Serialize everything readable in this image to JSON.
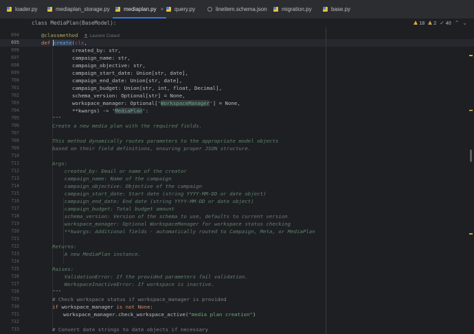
{
  "tabs": [
    {
      "label": "loader.py",
      "icon": "python-file-icon",
      "active": false
    },
    {
      "label": "mediaplan_storage.py",
      "icon": "python-file-icon",
      "active": false
    },
    {
      "label": "mediaplan.py",
      "icon": "python-file-icon",
      "active": true
    },
    {
      "label": "query.py",
      "icon": "python-file-icon",
      "active": false
    },
    {
      "label": "lineitem.schema.json",
      "icon": "json-file-icon",
      "active": false
    },
    {
      "label": "migration.py",
      "icon": "python-file-icon",
      "active": false
    },
    {
      "label": "base.py",
      "icon": "python-file-icon",
      "active": false
    }
  ],
  "tab_close_glyph": "×",
  "breadcrumb": "class MediaPlan(BaseModel):",
  "inspections": {
    "warnings": "18",
    "weak_warnings": "2",
    "passed": "40"
  },
  "line_numbers": [
    "694",
    "695",
    "696",
    "697",
    "698",
    "699",
    "700",
    "701",
    "702",
    "703",
    "704",
    "705",
    "706",
    "707",
    "708",
    "709",
    "710",
    "711",
    "712",
    "713",
    "714",
    "715",
    "716",
    "717",
    "718",
    "719",
    "720",
    "721",
    "722",
    "723",
    "724",
    "725",
    "726",
    "727",
    "728",
    "729",
    "730",
    "731",
    "732",
    "733"
  ],
  "code": {
    "decorator": "@classmethod",
    "author_hint": "Laurent Colard",
    "def_kw": "def",
    "method_name": "create",
    "cls_open": "(cls,",
    "params": [
      "created_by: str,",
      "campaign_name: str,",
      "campaign_objective: str,",
      "campaign_start_date: Union[str, date],",
      "campaign_end_date: Union[str, date],",
      "campaign_budget: Union[str, int, float, Decimal],",
      "schema_version: Optional[str] = None,"
    ],
    "wm_prefix": "workspace_manager: Optional['",
    "wm_type": "WorkspaceManager",
    "wm_suffix": "'] = None,",
    "kwargs_prefix": "**kwargs) -> '",
    "kwargs_type": "MediaPlan",
    "kwargs_suffix": "':",
    "doc_open": "\"\"\"",
    "doc_lines": [
      "Create a new media plan with the required fields.",
      "",
      "This method dynamically routes parameters to the appropriate model objects",
      "based on their field definitions, ensuring proper JSON structure.",
      "",
      "Args:",
      "    created_by: Email or name of the creator",
      "    campaign_name: Name of the campaign",
      "    campaign_objective: Objective of the campaign",
      "    campaign_start_date: Start date (string YYYY-MM-DD or date object)",
      "    campaign_end_date: End date (string YYYY-MM-DD or date object)",
      "    campaign_budget: Total budget amount",
      "    schema_version: Version of the schema to use, defaults to current version",
      "    workspace_manager: Optional WorkspaceManager for workspace status checking",
      "    **kwargs: Additional fields - automatically routed to Campaign, Meta, or MediaPlan",
      "",
      "Returns:",
      "    A new MediaPlan instance.",
      "",
      "Raises:",
      "    ValidationError: If the provided parameters fail validation.",
      "    WorkspaceInactiveError: If workspace is inactive.",
      "\"\"\""
    ],
    "comment1": "# Check workspace status if workspace_manager is provided",
    "if_kw": "if",
    "if_cond": " workspace_manager ",
    "is_not": "is not",
    "none_kw": " None",
    "colon": ":",
    "call_prefix": "workspace_manager.check_workspace_active(",
    "call_str": "\"media plan creation\"",
    "call_suffix": ")",
    "comment2": "# Convert date strings to date objects if necessary"
  },
  "colors": {
    "background": "#1e1f22",
    "tabbar": "#2b2d30",
    "accent": "#3574f0",
    "keyword": "#cf8e6d",
    "function": "#56a8f5",
    "string": "#6aab73",
    "docstring": "#5f826b",
    "decorator": "#b3ae60"
  }
}
